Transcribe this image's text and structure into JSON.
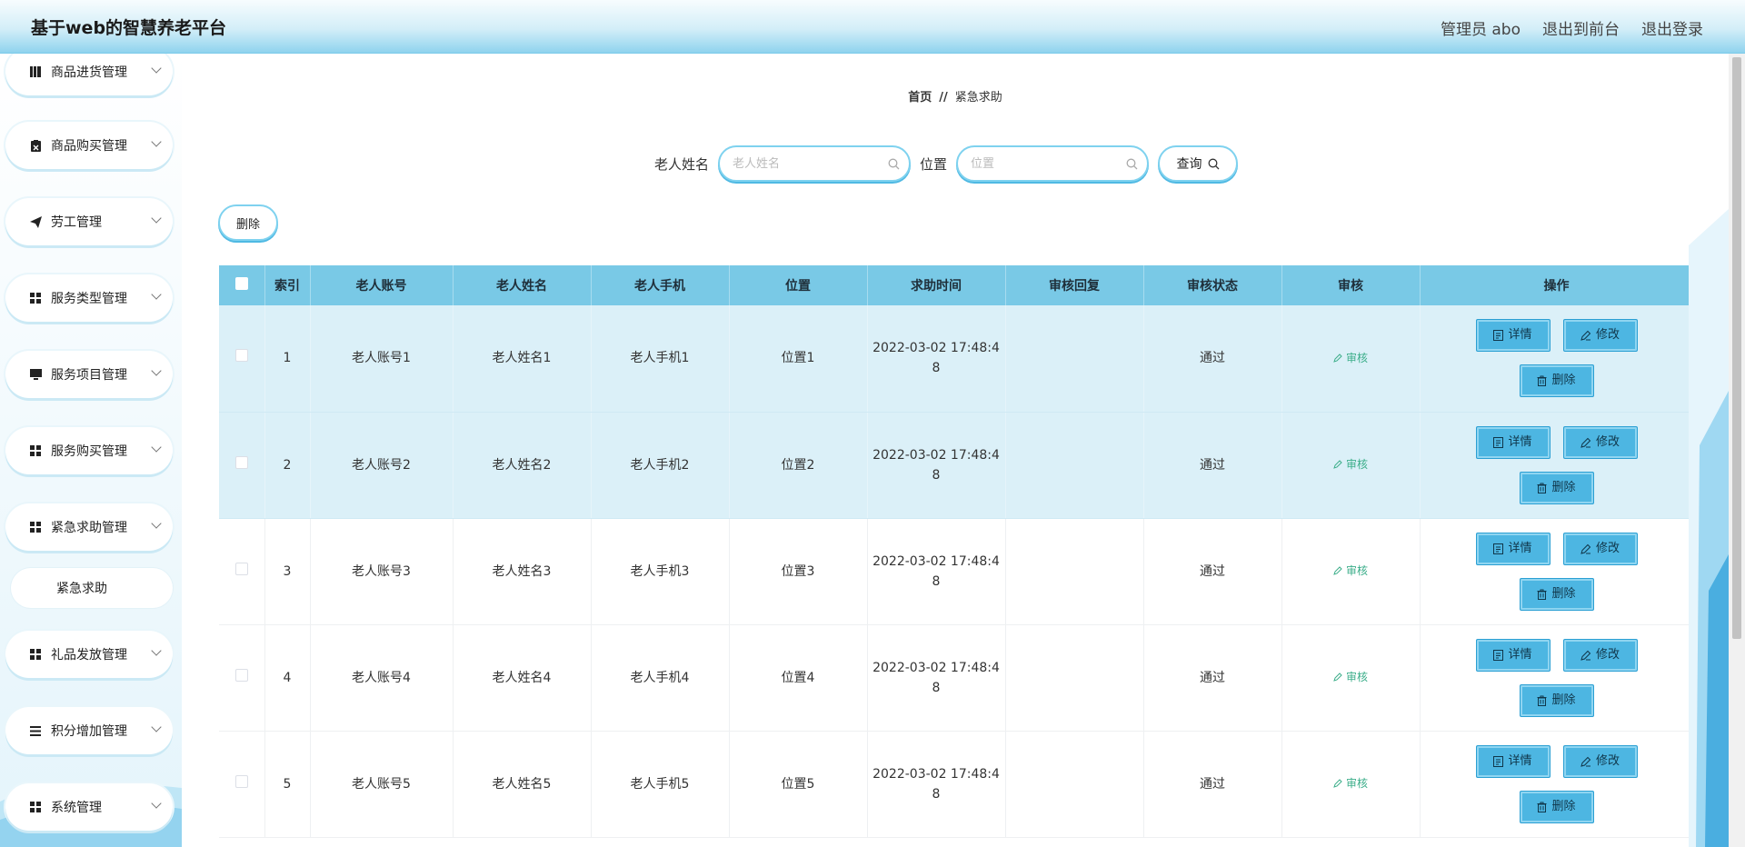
{
  "header": {
    "title": "基于web的智慧养老平台",
    "user": "管理员 abo",
    "to_front": "退出到前台",
    "logout": "退出登录"
  },
  "sidebar": {
    "items": [
      {
        "label": "商品进货管理",
        "icon": "book-icon"
      },
      {
        "label": "商品购买管理",
        "icon": "clipboard-icon"
      },
      {
        "label": "劳工管理",
        "icon": "send-icon"
      },
      {
        "label": "服务类型管理",
        "icon": "grid-icon"
      },
      {
        "label": "服务项目管理",
        "icon": "monitor-icon"
      },
      {
        "label": "服务购买管理",
        "icon": "grid-icon"
      },
      {
        "label": "紧急求助管理",
        "icon": "grid-icon"
      },
      {
        "label": "礼品发放管理",
        "icon": "grid-icon"
      },
      {
        "label": "积分增加管理",
        "icon": "list-icon"
      },
      {
        "label": "系统管理",
        "icon": "grid-icon"
      }
    ],
    "submenu": {
      "label": "紧急求助"
    }
  },
  "breadcrumb": {
    "home": "首页",
    "sep": "//",
    "current": "紧急求助"
  },
  "search": {
    "name_label": "老人姓名",
    "name_placeholder": "老人姓名",
    "name_value": "",
    "location_label": "位置",
    "location_placeholder": "位置",
    "location_value": "",
    "query_label": "查询"
  },
  "toolbar": {
    "delete_label": "删除"
  },
  "table": {
    "columns": [
      "索引",
      "老人账号",
      "老人姓名",
      "老人手机",
      "位置",
      "求助时间",
      "审核回复",
      "审核状态",
      "审核",
      "操作"
    ],
    "rows": [
      {
        "index": "1",
        "account": "老人账号1",
        "name": "老人姓名1",
        "phone": "老人手机1",
        "location": "位置1",
        "time_line1": "2022-03-02 17:48:4",
        "time_line2": "8",
        "reply": "",
        "status": "通过",
        "audit": "审核"
      },
      {
        "index": "2",
        "account": "老人账号2",
        "name": "老人姓名2",
        "phone": "老人手机2",
        "location": "位置2",
        "time_line1": "2022-03-02 17:48:4",
        "time_line2": "8",
        "reply": "",
        "status": "通过",
        "audit": "审核"
      },
      {
        "index": "3",
        "account": "老人账号3",
        "name": "老人姓名3",
        "phone": "老人手机3",
        "location": "位置3",
        "time_line1": "2022-03-02 17:48:4",
        "time_line2": "8",
        "reply": "",
        "status": "通过",
        "audit": "审核"
      },
      {
        "index": "4",
        "account": "老人账号4",
        "name": "老人姓名4",
        "phone": "老人手机4",
        "location": "位置4",
        "time_line1": "2022-03-02 17:48:4",
        "time_line2": "8",
        "reply": "",
        "status": "通过",
        "audit": "审核"
      },
      {
        "index": "5",
        "account": "老人账号5",
        "name": "老人姓名5",
        "phone": "老人手机5",
        "location": "位置5",
        "time_line1": "2022-03-02 17:48:4",
        "time_line2": "8",
        "reply": "",
        "status": "通过",
        "audit": "审核"
      }
    ],
    "actions": {
      "detail": "详情",
      "edit": "修改",
      "delete": "删除"
    }
  },
  "colors": {
    "accent": "#4db6e2",
    "header_row": "#79c9e6",
    "highlight_row": "#dbf0f8",
    "audit_link": "#3cae8a"
  }
}
